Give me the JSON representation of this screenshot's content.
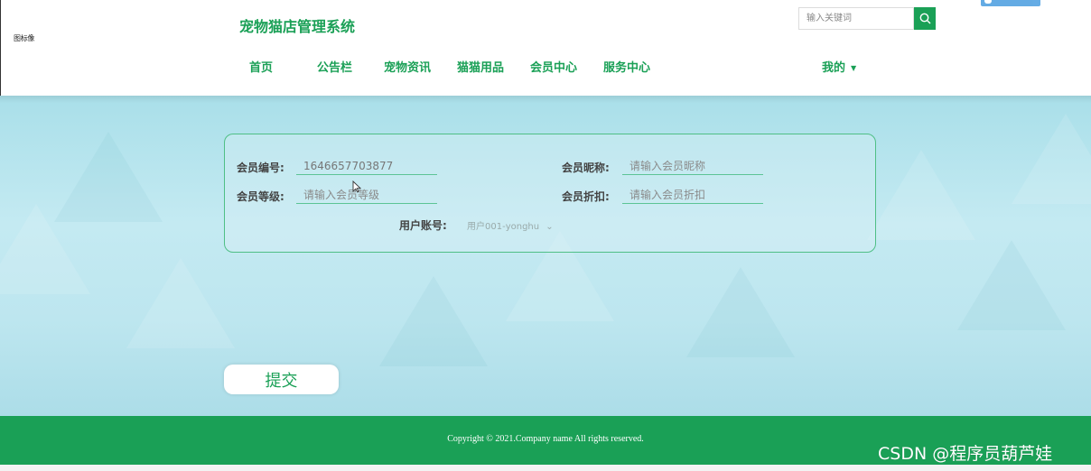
{
  "header": {
    "broken_image_alt": "图标像",
    "site_title": "宠物猫店管理系统",
    "nav": [
      {
        "label": "首页"
      },
      {
        "label": "公告栏"
      },
      {
        "label": "宠物资讯"
      },
      {
        "label": "猫猫用品"
      },
      {
        "label": "会员中心"
      },
      {
        "label": "服务中心"
      }
    ],
    "my_menu_label": "我的",
    "search": {
      "placeholder": "输入关键词",
      "icon": "search-icon"
    }
  },
  "form": {
    "member_no": {
      "label": "会员编号:",
      "value": "1646657703877"
    },
    "member_nickname": {
      "label": "会员昵称:",
      "placeholder": "请输入会员昵称"
    },
    "member_level": {
      "label": "会员等级:",
      "placeholder": "请输入会员等级"
    },
    "member_discount": {
      "label": "会员折扣:",
      "placeholder": "请输入会员折扣"
    },
    "user_account": {
      "label": "用户账号:",
      "selected": "用户001-yonghu"
    }
  },
  "submit_label": "提交",
  "footer": {
    "copyright": "Copyright © 2021.Company name All rights reserved."
  },
  "watermark": "CSDN @程序员葫芦娃",
  "colors": {
    "brand_green": "#1aa056",
    "panel_border": "#4fbf86",
    "background_blue": "#bde6ef"
  }
}
